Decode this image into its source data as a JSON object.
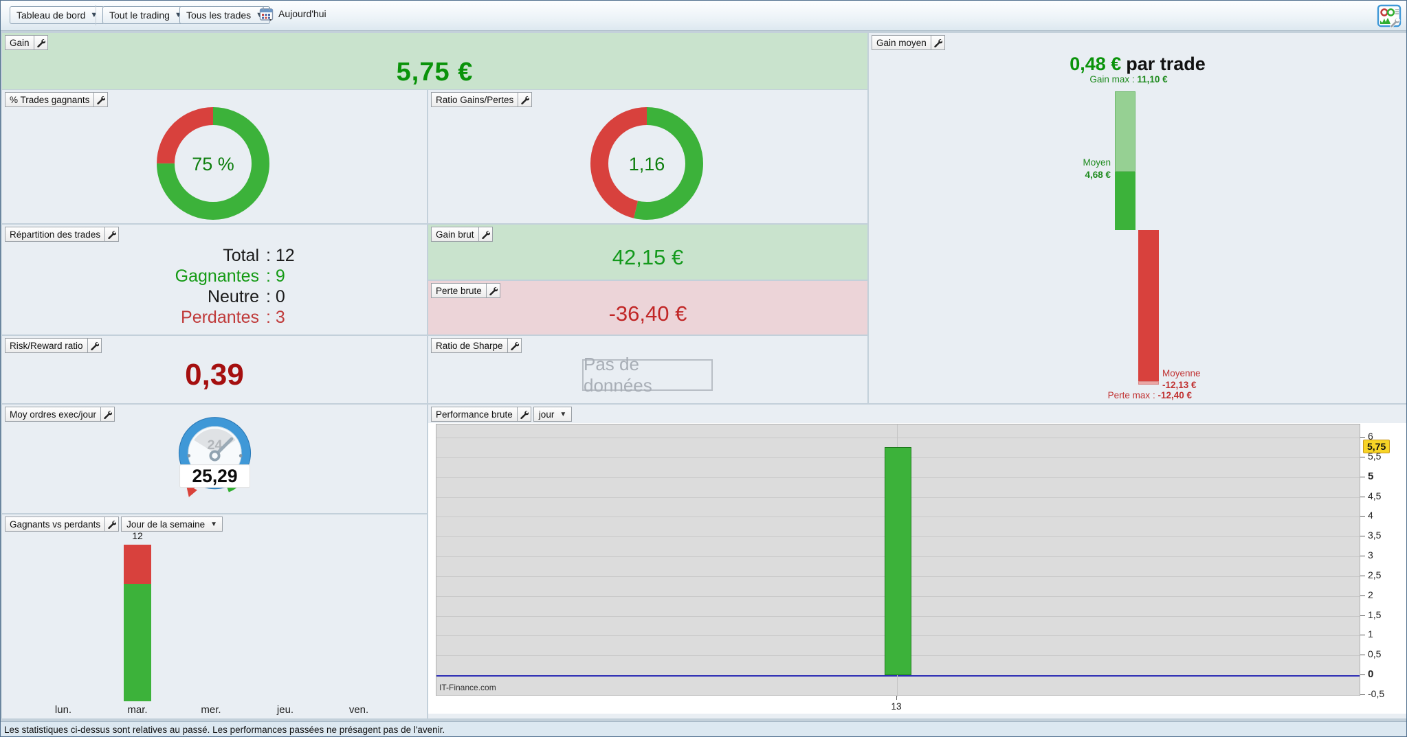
{
  "toolbar": {
    "dashboard_menu": "Tableau de bord",
    "scope_menu": "Tout le trading",
    "trades_menu": "Tous les trades",
    "today_label": "Aujourd'hui",
    "icons": [
      "calendar-icon",
      "dashboard-settings-icon",
      "wrench-icon"
    ]
  },
  "panels": {
    "gain": {
      "title": "Gain",
      "value": "5,75 €",
      "accent_color": "#0a930a",
      "bg_color": "#c9e3cd"
    },
    "pct_trades_gagnants": {
      "title": "% Trades gagnants",
      "center_label": "75 %"
    },
    "ratio_gains_pertes": {
      "title": "Ratio Gains/Pertes",
      "center_label": "1,16"
    },
    "repartition": {
      "title": "Répartition des trades",
      "rows": [
        {
          "label": "Total",
          "value": "12",
          "color": "#1a1a1a"
        },
        {
          "label": "Gagnantes",
          "value": "9",
          "color": "#149a14"
        },
        {
          "label": "Neutre",
          "value": "0",
          "color": "#1a1a1a"
        },
        {
          "label": "Perdantes",
          "value": "3",
          "color": "#c03a3a"
        }
      ]
    },
    "gain_brut": {
      "title": "Gain brut",
      "value": "42,15 €",
      "accent_color": "#13991c",
      "bg_color": "#c9e3cd"
    },
    "perte_brute": {
      "title": "Perte brute",
      "value": "-36,40 €",
      "accent_color": "#c12626",
      "bg_color": "#ecd4d8"
    },
    "risk_reward": {
      "title": "Risk/Reward ratio",
      "value": "0,39",
      "accent_color": "#a50f0f"
    },
    "ratio_sharpe": {
      "title": "Ratio de Sharpe",
      "no_data_label": "Pas de données"
    },
    "gain_moyen": {
      "title": "Gain moyen",
      "headline_value": "0,48 €",
      "headline_suffix": "par trade",
      "gain_max_label": "Gain max",
      "gain_max_value": "11,10 €",
      "moyen_label": "Moyen",
      "moyen_value": "4,68 €",
      "moyenne_label": "Moyenne",
      "moyenne_value": "-12,13 €",
      "perte_max_label": "Perte max",
      "perte_max_value": "-12,40 €"
    },
    "moy_ordres": {
      "title": "Moy ordres exec/jour",
      "value": "25,29",
      "gauge_number": "24"
    },
    "gagnants_vs_perdants": {
      "title": "Gagnants vs perdants",
      "period_selector": "Jour de la semaine"
    },
    "performance_brute": {
      "title": "Performance brute",
      "period_selector": "jour",
      "watermark": "IT-Finance.com",
      "current_value_badge": "5,75",
      "x_tick_label": "13"
    }
  },
  "footer": {
    "disclaimer": "Les statistiques ci-dessus sont relatives au passé. Les performances passées ne présagent pas de l'avenir."
  },
  "chart_data": [
    {
      "id": "winning-trades-donut",
      "type": "pie",
      "title": "% Trades gagnants",
      "slices": [
        {
          "name": "gagnants",
          "value": 75,
          "color": "#3cb23a"
        },
        {
          "name": "perdants",
          "value": 25,
          "color": "#d8413d"
        }
      ],
      "center_label": "75 %"
    },
    {
      "id": "gains-losses-ratio-donut",
      "type": "pie",
      "title": "Ratio Gains/Pertes",
      "slices": [
        {
          "name": "gains",
          "value": 1.16,
          "color": "#3cb23a"
        },
        {
          "name": "pertes",
          "value": 1.0,
          "color": "#d8413d"
        }
      ],
      "center_label": "1,16"
    },
    {
      "id": "gain-moyen-range",
      "type": "bar",
      "title": "Gain moyen (€ par trade)",
      "average_per_trade": 0.48,
      "gain_max": 11.1,
      "gain_moyen": 4.68,
      "perte_moyenne": -12.13,
      "perte_max": -12.4,
      "colors": {
        "gain_max": "#96d093",
        "gain": "#3cb23a",
        "perte": "#d8413d",
        "perte_max": "#eba6a4"
      }
    },
    {
      "id": "weekday-win-lose",
      "type": "bar",
      "title": "Gagnants vs perdants par jour de la semaine",
      "categories": [
        "lun.",
        "mar.",
        "mer.",
        "jeu.",
        "ven."
      ],
      "series": [
        {
          "name": "gagnants",
          "values": [
            0,
            9,
            0,
            0,
            0
          ],
          "color": "#3cb23a"
        },
        {
          "name": "perdants",
          "values": [
            0,
            3,
            0,
            0,
            0
          ],
          "color": "#d8413d"
        }
      ],
      "total_labels": [
        "",
        "12",
        "",
        "",
        ""
      ]
    },
    {
      "id": "performance-brute-chart",
      "type": "bar",
      "title": "Performance brute par jour",
      "categories": [
        "13"
      ],
      "values": [
        5.75
      ],
      "ylim": [
        -0.5,
        6
      ],
      "ytick_step": 0.5,
      "bold_ticks": [
        0,
        5
      ],
      "bar_color": "#3cb23a",
      "bar_border": "#1d7a1d",
      "zero_line_color": "#2d2db4",
      "grid": true,
      "current_value": 5.75
    }
  ]
}
